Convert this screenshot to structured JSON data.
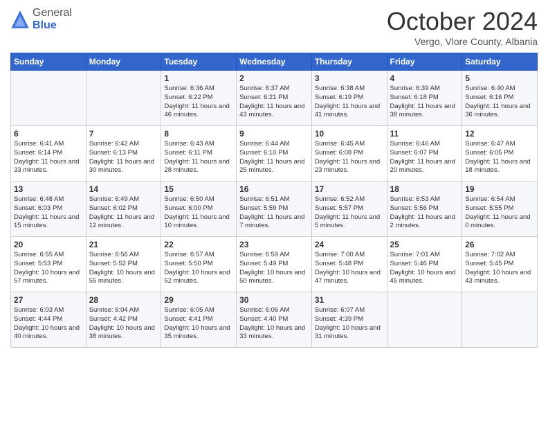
{
  "header": {
    "logo_general": "General",
    "logo_blue": "Blue",
    "title": "October 2024",
    "location": "Vergo, Vlore County, Albania"
  },
  "days_of_week": [
    "Sunday",
    "Monday",
    "Tuesday",
    "Wednesday",
    "Thursday",
    "Friday",
    "Saturday"
  ],
  "weeks": [
    [
      {
        "day": "",
        "content": ""
      },
      {
        "day": "",
        "content": ""
      },
      {
        "day": "1",
        "content": "Sunrise: 6:36 AM\nSunset: 6:22 PM\nDaylight: 11 hours and 46 minutes."
      },
      {
        "day": "2",
        "content": "Sunrise: 6:37 AM\nSunset: 6:21 PM\nDaylight: 11 hours and 43 minutes."
      },
      {
        "day": "3",
        "content": "Sunrise: 6:38 AM\nSunset: 6:19 PM\nDaylight: 11 hours and 41 minutes."
      },
      {
        "day": "4",
        "content": "Sunrise: 6:39 AM\nSunset: 6:18 PM\nDaylight: 11 hours and 38 minutes."
      },
      {
        "day": "5",
        "content": "Sunrise: 6:40 AM\nSunset: 6:16 PM\nDaylight: 11 hours and 36 minutes."
      }
    ],
    [
      {
        "day": "6",
        "content": "Sunrise: 6:41 AM\nSunset: 6:14 PM\nDaylight: 11 hours and 33 minutes."
      },
      {
        "day": "7",
        "content": "Sunrise: 6:42 AM\nSunset: 6:13 PM\nDaylight: 11 hours and 30 minutes."
      },
      {
        "day": "8",
        "content": "Sunrise: 6:43 AM\nSunset: 6:11 PM\nDaylight: 11 hours and 28 minutes."
      },
      {
        "day": "9",
        "content": "Sunrise: 6:44 AM\nSunset: 6:10 PM\nDaylight: 11 hours and 25 minutes."
      },
      {
        "day": "10",
        "content": "Sunrise: 6:45 AM\nSunset: 6:08 PM\nDaylight: 11 hours and 23 minutes."
      },
      {
        "day": "11",
        "content": "Sunrise: 6:46 AM\nSunset: 6:07 PM\nDaylight: 11 hours and 20 minutes."
      },
      {
        "day": "12",
        "content": "Sunrise: 6:47 AM\nSunset: 6:05 PM\nDaylight: 11 hours and 18 minutes."
      }
    ],
    [
      {
        "day": "13",
        "content": "Sunrise: 6:48 AM\nSunset: 6:03 PM\nDaylight: 11 hours and 15 minutes."
      },
      {
        "day": "14",
        "content": "Sunrise: 6:49 AM\nSunset: 6:02 PM\nDaylight: 11 hours and 12 minutes."
      },
      {
        "day": "15",
        "content": "Sunrise: 6:50 AM\nSunset: 6:00 PM\nDaylight: 11 hours and 10 minutes."
      },
      {
        "day": "16",
        "content": "Sunrise: 6:51 AM\nSunset: 5:59 PM\nDaylight: 11 hours and 7 minutes."
      },
      {
        "day": "17",
        "content": "Sunrise: 6:52 AM\nSunset: 5:57 PM\nDaylight: 11 hours and 5 minutes."
      },
      {
        "day": "18",
        "content": "Sunrise: 6:53 AM\nSunset: 5:56 PM\nDaylight: 11 hours and 2 minutes."
      },
      {
        "day": "19",
        "content": "Sunrise: 6:54 AM\nSunset: 5:55 PM\nDaylight: 11 hours and 0 minutes."
      }
    ],
    [
      {
        "day": "20",
        "content": "Sunrise: 6:55 AM\nSunset: 5:53 PM\nDaylight: 10 hours and 57 minutes."
      },
      {
        "day": "21",
        "content": "Sunrise: 6:56 AM\nSunset: 5:52 PM\nDaylight: 10 hours and 55 minutes."
      },
      {
        "day": "22",
        "content": "Sunrise: 6:57 AM\nSunset: 5:50 PM\nDaylight: 10 hours and 52 minutes."
      },
      {
        "day": "23",
        "content": "Sunrise: 6:59 AM\nSunset: 5:49 PM\nDaylight: 10 hours and 50 minutes."
      },
      {
        "day": "24",
        "content": "Sunrise: 7:00 AM\nSunset: 5:48 PM\nDaylight: 10 hours and 47 minutes."
      },
      {
        "day": "25",
        "content": "Sunrise: 7:01 AM\nSunset: 5:46 PM\nDaylight: 10 hours and 45 minutes."
      },
      {
        "day": "26",
        "content": "Sunrise: 7:02 AM\nSunset: 5:45 PM\nDaylight: 10 hours and 43 minutes."
      }
    ],
    [
      {
        "day": "27",
        "content": "Sunrise: 6:03 AM\nSunset: 4:44 PM\nDaylight: 10 hours and 40 minutes."
      },
      {
        "day": "28",
        "content": "Sunrise: 6:04 AM\nSunset: 4:42 PM\nDaylight: 10 hours and 38 minutes."
      },
      {
        "day": "29",
        "content": "Sunrise: 6:05 AM\nSunset: 4:41 PM\nDaylight: 10 hours and 35 minutes."
      },
      {
        "day": "30",
        "content": "Sunrise: 6:06 AM\nSunset: 4:40 PM\nDaylight: 10 hours and 33 minutes."
      },
      {
        "day": "31",
        "content": "Sunrise: 6:07 AM\nSunset: 4:39 PM\nDaylight: 10 hours and 31 minutes."
      },
      {
        "day": "",
        "content": ""
      },
      {
        "day": "",
        "content": ""
      }
    ]
  ]
}
